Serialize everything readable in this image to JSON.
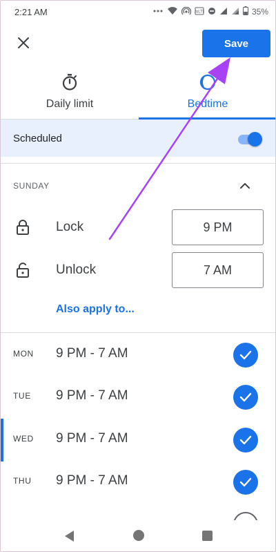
{
  "status_bar": {
    "time": "2:21 AM",
    "battery": "35%",
    "icons": [
      "signal-dots-icon",
      "wifi-icon",
      "hotspot-icon",
      "volte-icon",
      "do-not-disturb-icon",
      "sim-icon",
      "signal-icon",
      "battery-icon"
    ]
  },
  "toolbar": {
    "close_icon": "close-icon",
    "save_label": "Save"
  },
  "tabs": [
    {
      "label": "Daily limit",
      "icon": "timer-icon",
      "active": false
    },
    {
      "label": "Bedtime",
      "icon": "moon-icon",
      "active": true
    }
  ],
  "scheduled": {
    "label": "Scheduled",
    "enabled": true
  },
  "day_section": {
    "title": "SUNDAY",
    "collapse_icon": "chevron-up-icon",
    "lock": {
      "label": "Lock",
      "value": "9 PM",
      "icon": "lock-icon"
    },
    "unlock": {
      "label": "Unlock",
      "value": "7 AM",
      "icon": "unlock-icon"
    },
    "also_apply": "Also apply to..."
  },
  "days": [
    {
      "day": "MON",
      "range": "9 PM - 7 AM",
      "checked": true
    },
    {
      "day": "TUE",
      "range": "9 PM - 7 AM",
      "checked": true
    },
    {
      "day": "WED",
      "range": "9 PM - 7 AM",
      "checked": true
    },
    {
      "day": "THU",
      "range": "9 PM - 7 AM",
      "checked": true
    }
  ],
  "colors": {
    "accent": "#1a73e8",
    "highlight": "#e8f0fe",
    "annotation_arrow": "#a742f5"
  },
  "nav_bar": {
    "icons": [
      "back-icon",
      "home-icon",
      "recents-icon"
    ]
  }
}
